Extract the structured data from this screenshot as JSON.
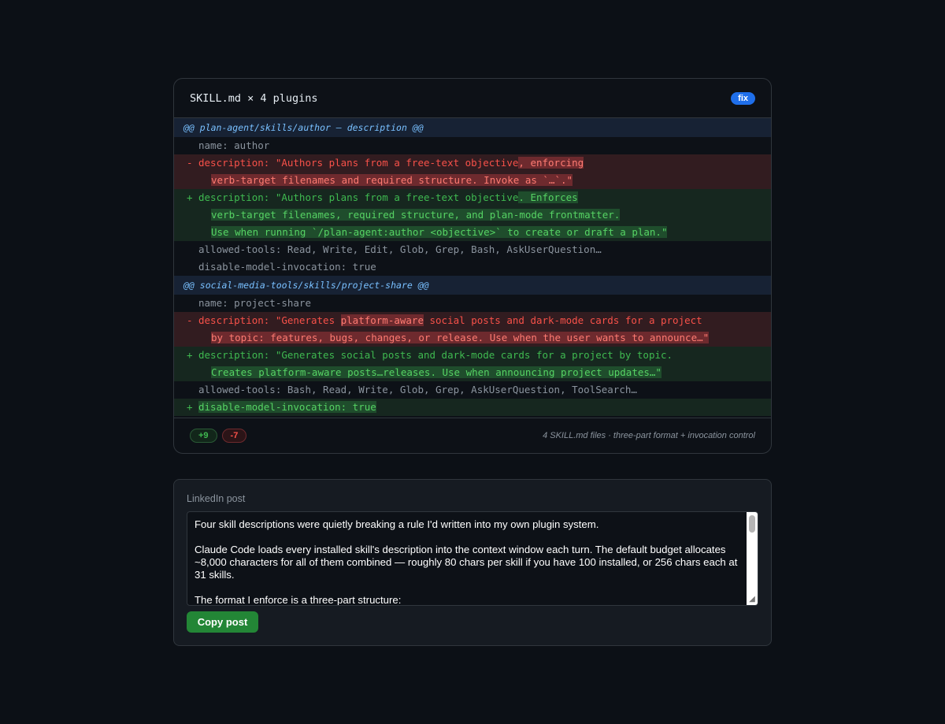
{
  "diff_card": {
    "title": "SKILL.md × 4 plugins",
    "badge": "fix",
    "hunks": [
      {
        "header": "@@ plan-agent/skills/author — description @@",
        "lines": [
          {
            "type": "ctx",
            "mark": " ",
            "segments": [
              {
                "text": "name: author"
              }
            ]
          },
          {
            "type": "del",
            "mark": "-",
            "segments": [
              {
                "text": "description: \"Authors plans from a free-text objective"
              },
              {
                "text": ", enforcing",
                "hl": true
              }
            ]
          },
          {
            "type": "del",
            "mark": "",
            "cont": true,
            "segments": [
              {
                "text": "verb-target filenames and required structure. Invoke as `…`.\"",
                "hl": true
              }
            ]
          },
          {
            "type": "add",
            "mark": "+",
            "segments": [
              {
                "text": "description: \"Authors plans from a free-text objective"
              },
              {
                "text": ". Enforces",
                "hl": true
              }
            ]
          },
          {
            "type": "add",
            "mark": "",
            "cont": true,
            "segments": [
              {
                "text": "verb-target filenames, required structure, and plan-mode frontmatter.",
                "hl": true
              }
            ]
          },
          {
            "type": "add",
            "mark": "",
            "cont": true,
            "segments": [
              {
                "text": "Use when running `/plan-agent:author <objective>` to create or draft a plan.\"",
                "hl": true
              }
            ]
          },
          {
            "type": "ctx",
            "mark": " ",
            "segments": [
              {
                "text": "allowed-tools: Read, Write, Edit, Glob, Grep, Bash, AskUserQuestion…"
              }
            ]
          },
          {
            "type": "ctx",
            "mark": " ",
            "segments": [
              {
                "text": "disable-model-invocation: true"
              }
            ]
          }
        ]
      },
      {
        "header": "@@ social-media-tools/skills/project-share @@",
        "lines": [
          {
            "type": "ctx",
            "mark": " ",
            "segments": [
              {
                "text": "name: project-share"
              }
            ]
          },
          {
            "type": "del",
            "mark": "-",
            "segments": [
              {
                "text": "description: \"Generates "
              },
              {
                "text": "platform-aware",
                "hl": true
              },
              {
                "text": " social posts and dark-mode cards for a project"
              }
            ]
          },
          {
            "type": "del",
            "mark": "",
            "cont": true,
            "segments": [
              {
                "text": "by topic: features, bugs, changes, or release. Use when the user wants to announce…\"",
                "hl": true
              }
            ]
          },
          {
            "type": "add",
            "mark": "+",
            "segments": [
              {
                "text": "description: \"Generates social posts and dark-mode cards for a project by topic."
              }
            ]
          },
          {
            "type": "add",
            "mark": "",
            "cont": true,
            "segments": [
              {
                "text": "Creates platform-aware posts…releases. Use when announcing project updates…\"",
                "hl": true
              }
            ]
          },
          {
            "type": "ctx",
            "mark": " ",
            "segments": [
              {
                "text": "allowed-tools: Bash, Read, Write, Glob, Grep, AskUserQuestion, ToolSearch…"
              }
            ]
          },
          {
            "type": "add",
            "mark": "+",
            "segments": [
              {
                "text": "disable-model-invocation: true",
                "hl": true
              }
            ]
          }
        ]
      }
    ],
    "additions": "+9",
    "deletions": "-7",
    "footer_note": "4 SKILL.md files · three-part format + invocation control"
  },
  "post": {
    "label": "LinkedIn post",
    "text": "Four skill descriptions were quietly breaking a rule I'd written into my own plugin system.\n\nClaude Code loads every installed skill's description into the context window each turn. The default budget allocates ~8,000 characters for all of them combined — roughly 80 chars per skill if you have 100 installed, or 256 chars each at 31 skills.\n\nThe format I enforce is a three-part structure:",
    "copy_label": "Copy post"
  },
  "icons": {
    "scrollbar": "scrollbar-thumb",
    "resize": "resize-handle-icon"
  }
}
